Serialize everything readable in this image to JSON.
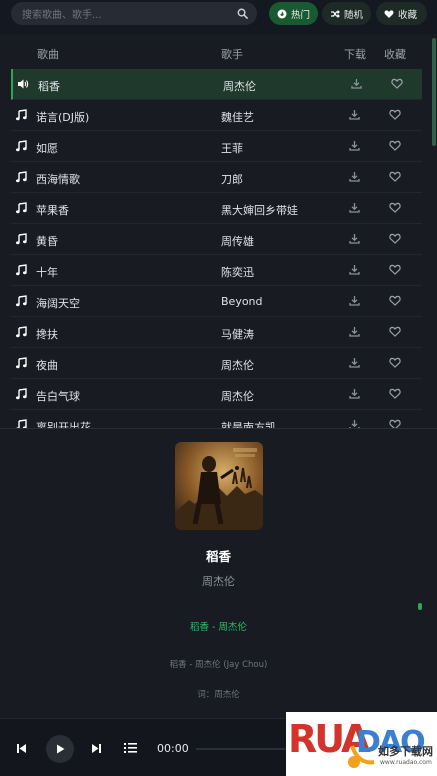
{
  "search": {
    "placeholder": "搜索歌曲、歌手..."
  },
  "filters": [
    {
      "label": "热门",
      "icon": "fire-icon",
      "active": true
    },
    {
      "label": "随机",
      "icon": "shuffle-icon",
      "active": false
    },
    {
      "label": "收藏",
      "icon": "heart-icon",
      "active": false
    }
  ],
  "table": {
    "headers": {
      "song": "歌曲",
      "artist": "歌手",
      "download": "下载",
      "favorite": "收藏"
    },
    "rows": [
      {
        "title": "稻香",
        "artist": "周杰伦",
        "playing": true
      },
      {
        "title": "诺言(DJ版)",
        "artist": "魏佳艺"
      },
      {
        "title": "如愿",
        "artist": "王菲"
      },
      {
        "title": "西海情歌",
        "artist": "刀郎"
      },
      {
        "title": "苹果香",
        "artist": "黑大婶回乡带娃"
      },
      {
        "title": "黄昏",
        "artist": "周传雄"
      },
      {
        "title": "十年",
        "artist": "陈奕迅"
      },
      {
        "title": "海阔天空",
        "artist": "Beyond"
      },
      {
        "title": "搀扶",
        "artist": "马健涛"
      },
      {
        "title": "夜曲",
        "artist": "周杰伦"
      },
      {
        "title": "告白气球",
        "artist": "周杰伦"
      },
      {
        "title": "离别开出花",
        "artist": "就是南方凯"
      }
    ]
  },
  "now_playing": {
    "title": "稻香",
    "artist": "周杰伦",
    "lyrics": {
      "active": "稻香 - 周杰伦",
      "line1": "稻香 - 周杰伦 (Jay Chou)",
      "line2": "词：周杰伦"
    }
  },
  "player": {
    "time": "00:00"
  },
  "watermark": {
    "brand": "RUANDAO",
    "subtitle": "如多下载网",
    "url": "www.ruadao.com"
  },
  "colors": {
    "accent": "#2fa55a",
    "background": "#181b22",
    "playing_row": "#1f3a2c"
  }
}
